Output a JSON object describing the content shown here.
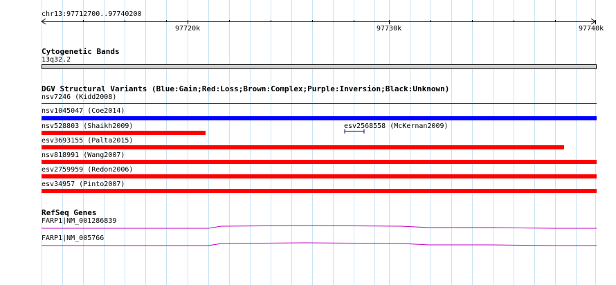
{
  "ruler": {
    "location": "chr13:97712700..97740200",
    "ticks": [
      "97720k",
      "97730k",
      "97740k"
    ]
  },
  "cytobands": {
    "title": "Cytogenetic Bands",
    "band": "13q32.2"
  },
  "dgv": {
    "title": "DGV Structural Variants (Blue:Gain;Red:Loss;Brown:Complex;Purple:Inversion;Black:Unknown)",
    "variants": [
      {
        "label": "nsv7246 (Kidd2008)",
        "color": "#800080"
      },
      {
        "label": "nsv1045047 (Coe2014)",
        "color": "#0000ff"
      },
      {
        "label": "nsv528803 (Shaikh2009)",
        "color": "#ff0000"
      },
      {
        "label": "esv2568558 (McKernan2009)",
        "color": "#000080"
      },
      {
        "label": "esv3693155 (Palta2015)",
        "color": "#ff0000"
      },
      {
        "label": "nsv818991 (Wang2007)",
        "color": "#ff0000"
      },
      {
        "label": "esv2759959 (Redon2006)",
        "color": "#ff0000"
      },
      {
        "label": "esv34957 (Pinto2007)",
        "color": "#ff0000"
      }
    ]
  },
  "refseq": {
    "title": "RefSeq Genes",
    "genes": [
      {
        "label": "FARP1|NM_001286839",
        "color": "#c000c0"
      },
      {
        "label": "FARP1|NM_005766",
        "color": "#c000c0"
      }
    ]
  }
}
